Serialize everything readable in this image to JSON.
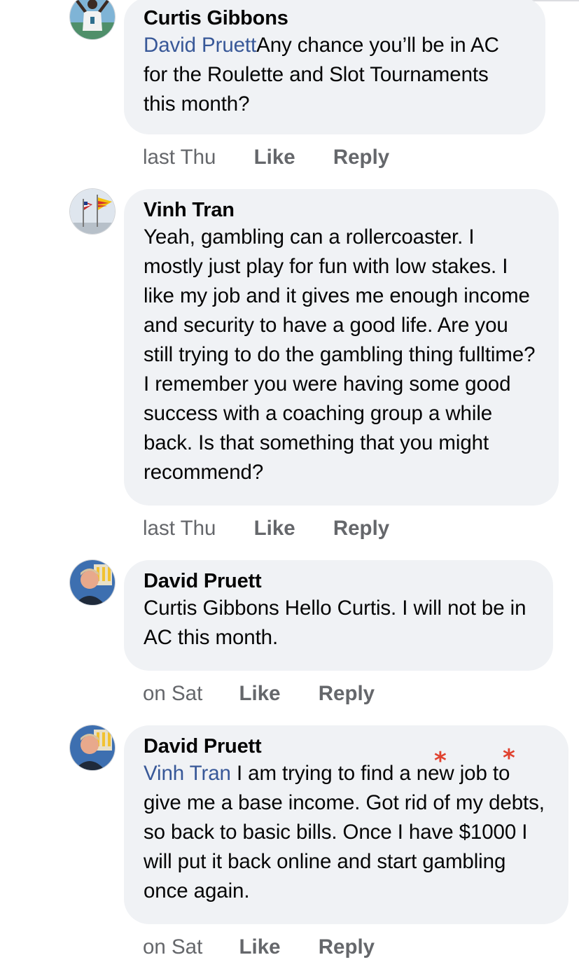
{
  "comments": [
    {
      "author": "Curtis Gibbons",
      "mention": "David Pruett",
      "text": "Any chance you’ll be in AC for the Roulette and Slot Tournaments this month?",
      "time": "last Thu",
      "like_label": "Like",
      "reply_label": "Reply"
    },
    {
      "author": "Vinh Tran",
      "mention": "",
      "text": "Yeah, gambling can a rollercoaster. I mostly just play for fun with low stakes. I like my job and it gives me enough income and security to have a good life. Are you still trying to do the gambling thing fulltime? I remember you were having some good success with a coaching group a while back. Is that something that you might recommend?",
      "time": "last Thu",
      "like_label": "Like",
      "reply_label": "Reply"
    },
    {
      "author": "David Pruett",
      "mention": "",
      "text": "Curtis Gibbons Hello Curtis. I will not be in AC this month.",
      "time": "on Sat",
      "like_label": "Like",
      "reply_label": "Reply"
    },
    {
      "author": "David Pruett",
      "mention": "Vinh Tran",
      "text": " I am trying to find a new job to give me a base income. Got rid of my debts, so back to basic bills. Once I have $1000 I will put it back online and start gambling once again.",
      "time": "on Sat",
      "like_label": "Like",
      "reply_label": "Reply"
    }
  ],
  "annotations": [
    "*",
    "*"
  ],
  "colors": {
    "bubble": "#f0f2f5",
    "mention": "#385898",
    "meta": "#65676b",
    "annotation": "#e0422f"
  },
  "icons": {
    "avatar_1": "player-photo-avatar",
    "avatar_2": "flags-photo-avatar",
    "avatar_3": "man-photo-avatar",
    "avatar_4": "man-photo-avatar"
  }
}
